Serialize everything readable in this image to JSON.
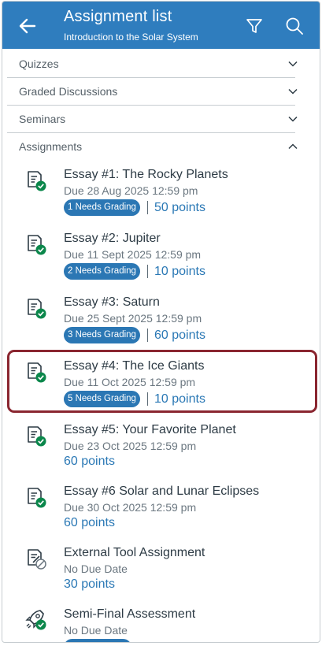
{
  "header": {
    "title": "Assignment list",
    "subtitle": "Introduction to the Solar System",
    "back_icon": "back-arrow-icon",
    "filter_icon": "filter-icon",
    "search_icon": "search-icon"
  },
  "groups": [
    {
      "label": "Quizzes",
      "state": "collapsed"
    },
    {
      "label": "Graded Discussions",
      "state": "collapsed"
    },
    {
      "label": "Seminars",
      "state": "collapsed"
    },
    {
      "label": "Assignments",
      "state": "expanded"
    }
  ],
  "assignments": [
    {
      "title": "Essay #1: The Rocky Planets",
      "due": "Due 28 Aug 2025 12:59 pm",
      "badge": "1 Needs Grading",
      "points": "50 points",
      "icon": "assignment-published-icon"
    },
    {
      "title": "Essay #2: Jupiter",
      "due": "Due 11 Sept 2025 12:59 pm",
      "badge": "2 Needs Grading",
      "points": "10 points",
      "icon": "assignment-published-icon"
    },
    {
      "title": "Essay #3: Saturn",
      "due": "Due 25 Sept 2025 12:59 pm",
      "badge": "3 Needs Grading",
      "points": "60 points",
      "icon": "assignment-published-icon"
    },
    {
      "title": "Essay #4: The Ice Giants",
      "due": "Due 11 Oct 2025 12:59 pm",
      "badge": "5 Needs Grading",
      "points": "10 points",
      "icon": "assignment-published-icon",
      "highlighted": true
    },
    {
      "title": "Essay #5: Your Favorite Planet",
      "due": "Due 23 Oct 2025 12:59 pm",
      "points": "60 points",
      "icon": "assignment-published-icon"
    },
    {
      "title": "Essay #6 Solar and Lunar Eclipses",
      "due": "Due 30 Oct 2025 12:59 pm",
      "points": "60 points",
      "icon": "assignment-published-icon"
    },
    {
      "title": "External Tool Assignment",
      "due": "No Due Date",
      "points": "30 points",
      "icon": "external-tool-unpublished-icon"
    },
    {
      "title": "Semi-Final Assessment",
      "due": "No Due Date",
      "icon": "quiz-rocket-published-icon"
    }
  ],
  "colors": {
    "header_bg": "#2f7dbe",
    "badge_bg": "#2b77b4",
    "points_text": "#2a78b5",
    "published_green": "#0b874b",
    "highlight_border": "#8a2630"
  }
}
